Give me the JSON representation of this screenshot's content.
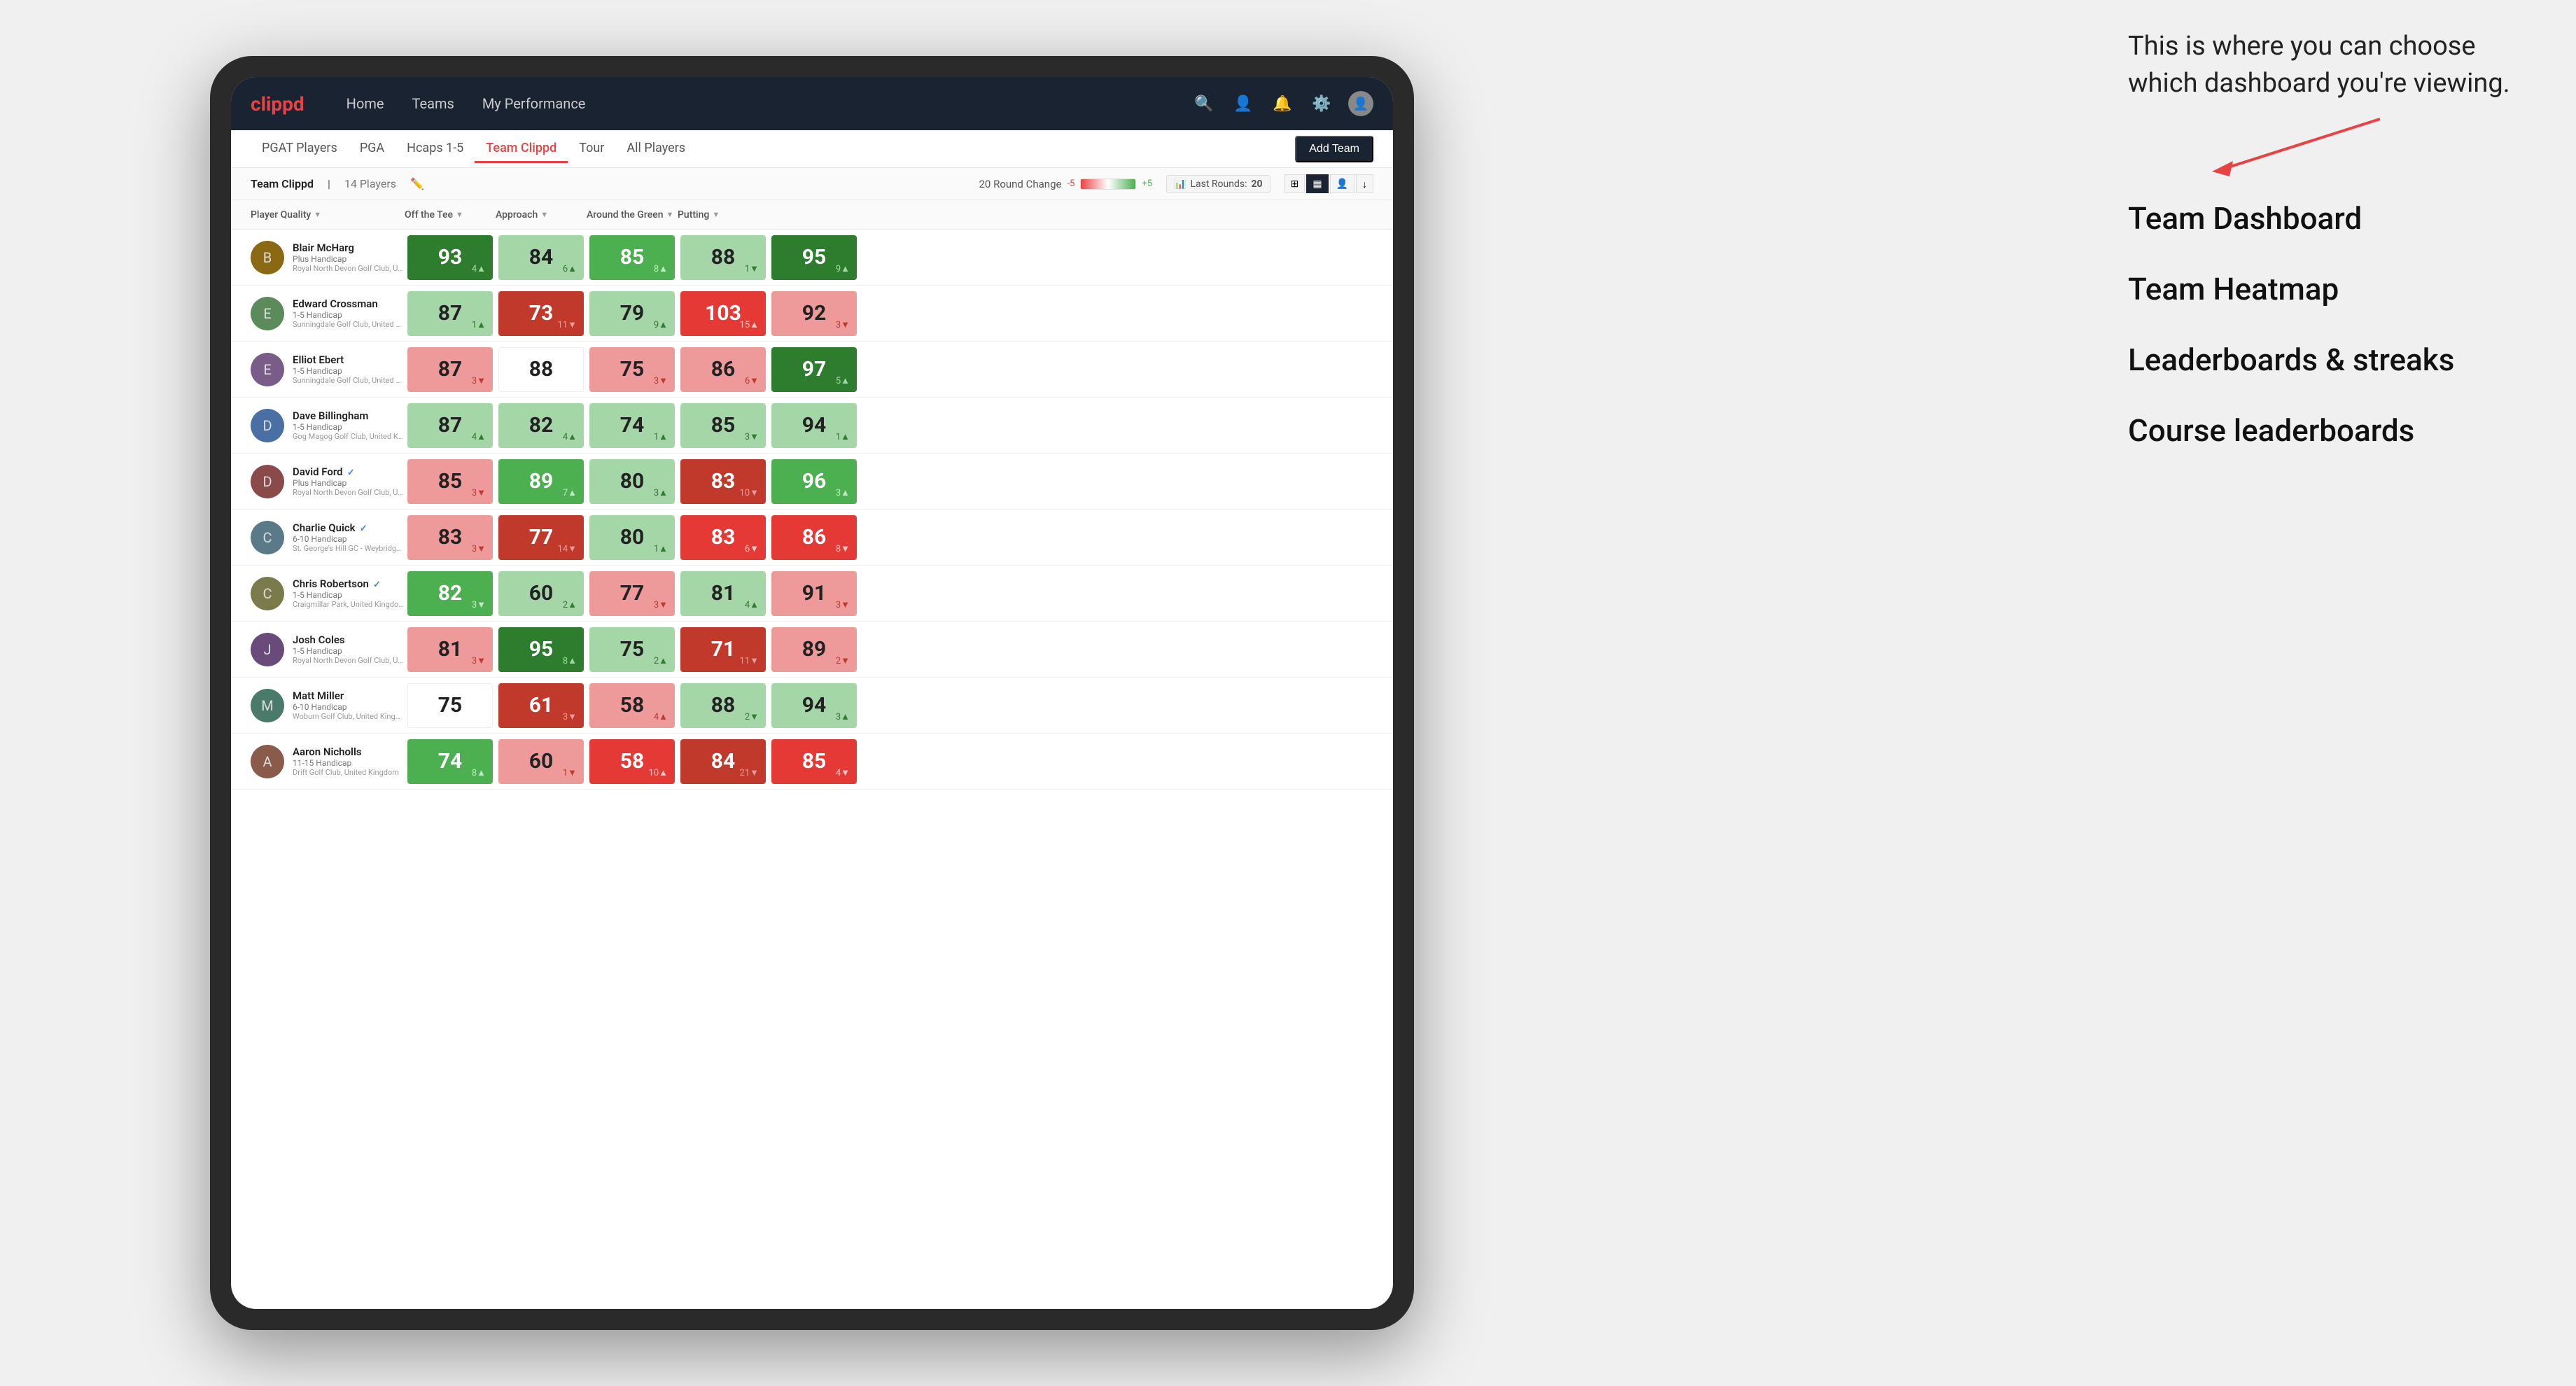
{
  "annotation": {
    "intro": "This is where you can choose which dashboard you're viewing.",
    "options": [
      "Team Dashboard",
      "Team Heatmap",
      "Leaderboards & streaks",
      "Course leaderboards"
    ]
  },
  "nav": {
    "logo": "clippd",
    "items": [
      "Home",
      "Teams",
      "My Performance"
    ],
    "icons": [
      "search",
      "person",
      "bell",
      "settings",
      "avatar"
    ]
  },
  "subnav": {
    "items": [
      "PGAT Players",
      "PGA",
      "Hcaps 1-5",
      "Team Clippd",
      "Tour",
      "All Players"
    ],
    "active": "Team Clippd",
    "add_team_label": "Add Team"
  },
  "team_header": {
    "team_name": "Team Clippd",
    "separator": "|",
    "player_count": "14 Players",
    "round_change_label": "20 Round Change",
    "change_neg": "-5",
    "change_pos": "+5",
    "last_rounds_label": "Last Rounds:",
    "last_rounds_value": "20"
  },
  "col_headers": [
    {
      "label": "Player Quality",
      "has_arrow": true
    },
    {
      "label": "Off the Tee",
      "has_arrow": true
    },
    {
      "label": "Approach",
      "has_arrow": true
    },
    {
      "label": "Around the Green",
      "has_arrow": true
    },
    {
      "label": "Putting",
      "has_arrow": true
    }
  ],
  "players": [
    {
      "name": "Blair McHarg",
      "handicap": "Plus Handicap",
      "club": "Royal North Devon Golf Club, United Kingdom",
      "verified": false,
      "scores": [
        {
          "value": 93,
          "change": "+4",
          "dir": "up",
          "color": "green-dark"
        },
        {
          "value": 84,
          "change": "+6",
          "dir": "up",
          "color": "green-light"
        },
        {
          "value": 85,
          "change": "+8",
          "dir": "up",
          "color": "green-mid"
        },
        {
          "value": 88,
          "change": "-1",
          "dir": "down",
          "color": "green-light"
        },
        {
          "value": 95,
          "change": "+9",
          "dir": "up",
          "color": "green-dark"
        }
      ]
    },
    {
      "name": "Edward Crossman",
      "handicap": "1-5 Handicap",
      "club": "Sunningdale Golf Club, United Kingdom",
      "verified": false,
      "scores": [
        {
          "value": 87,
          "change": "+1",
          "dir": "up",
          "color": "green-light"
        },
        {
          "value": 73,
          "change": "-11",
          "dir": "down",
          "color": "red-dark"
        },
        {
          "value": 79,
          "change": "+9",
          "dir": "up",
          "color": "green-light"
        },
        {
          "value": 103,
          "change": "+15",
          "dir": "up",
          "color": "red-mid"
        },
        {
          "value": 92,
          "change": "-3",
          "dir": "down",
          "color": "red-light"
        }
      ]
    },
    {
      "name": "Elliot Ebert",
      "handicap": "1-5 Handicap",
      "club": "Sunningdale Golf Club, United Kingdom",
      "verified": false,
      "scores": [
        {
          "value": 87,
          "change": "-3",
          "dir": "down",
          "color": "red-light"
        },
        {
          "value": 88,
          "change": "",
          "dir": "",
          "color": "white"
        },
        {
          "value": 75,
          "change": "-3",
          "dir": "down",
          "color": "red-light"
        },
        {
          "value": 86,
          "change": "-6",
          "dir": "down",
          "color": "red-light"
        },
        {
          "value": 97,
          "change": "+5",
          "dir": "up",
          "color": "green-dark"
        }
      ]
    },
    {
      "name": "Dave Billingham",
      "handicap": "1-5 Handicap",
      "club": "Gog Magog Golf Club, United Kingdom",
      "verified": false,
      "scores": [
        {
          "value": 87,
          "change": "+4",
          "dir": "up",
          "color": "green-light"
        },
        {
          "value": 82,
          "change": "+4",
          "dir": "up",
          "color": "green-light"
        },
        {
          "value": 74,
          "change": "+1",
          "dir": "up",
          "color": "green-light"
        },
        {
          "value": 85,
          "change": "-3",
          "dir": "down",
          "color": "green-light"
        },
        {
          "value": 94,
          "change": "+1",
          "dir": "up",
          "color": "green-light"
        }
      ]
    },
    {
      "name": "David Ford",
      "handicap": "Plus Handicap",
      "club": "Royal North Devon Golf Club, United Kingdom",
      "verified": true,
      "scores": [
        {
          "value": 85,
          "change": "-3",
          "dir": "down",
          "color": "red-light"
        },
        {
          "value": 89,
          "change": "+7",
          "dir": "up",
          "color": "green-mid"
        },
        {
          "value": 80,
          "change": "+3",
          "dir": "up",
          "color": "green-light"
        },
        {
          "value": 83,
          "change": "-10",
          "dir": "down",
          "color": "red-dark"
        },
        {
          "value": 96,
          "change": "+3",
          "dir": "up",
          "color": "green-mid"
        }
      ]
    },
    {
      "name": "Charlie Quick",
      "handicap": "6-10 Handicap",
      "club": "St. George's Hill GC - Weybridge - Surrey, Uni...",
      "verified": true,
      "scores": [
        {
          "value": 83,
          "change": "-3",
          "dir": "down",
          "color": "red-light"
        },
        {
          "value": 77,
          "change": "-14",
          "dir": "down",
          "color": "red-dark"
        },
        {
          "value": 80,
          "change": "+1",
          "dir": "up",
          "color": "green-light"
        },
        {
          "value": 83,
          "change": "-6",
          "dir": "down",
          "color": "red-mid"
        },
        {
          "value": 86,
          "change": "-8",
          "dir": "down",
          "color": "red-mid"
        }
      ]
    },
    {
      "name": "Chris Robertson",
      "handicap": "1-5 Handicap",
      "club": "Craigmillar Park, United Kingdom",
      "verified": true,
      "scores": [
        {
          "value": 82,
          "change": "-3",
          "dir": "down",
          "color": "green-mid"
        },
        {
          "value": 60,
          "change": "+2",
          "dir": "up",
          "color": "green-light"
        },
        {
          "value": 77,
          "change": "-3",
          "dir": "down",
          "color": "red-light"
        },
        {
          "value": 81,
          "change": "+4",
          "dir": "up",
          "color": "green-light"
        },
        {
          "value": 91,
          "change": "-3",
          "dir": "down",
          "color": "red-light"
        }
      ]
    },
    {
      "name": "Josh Coles",
      "handicap": "1-5 Handicap",
      "club": "Royal North Devon Golf Club, United Kingdom",
      "verified": false,
      "scores": [
        {
          "value": 81,
          "change": "-3",
          "dir": "down",
          "color": "red-light"
        },
        {
          "value": 95,
          "change": "+8",
          "dir": "up",
          "color": "green-dark"
        },
        {
          "value": 75,
          "change": "+2",
          "dir": "up",
          "color": "green-light"
        },
        {
          "value": 71,
          "change": "-11",
          "dir": "down",
          "color": "red-dark"
        },
        {
          "value": 89,
          "change": "-2",
          "dir": "down",
          "color": "red-light"
        }
      ]
    },
    {
      "name": "Matt Miller",
      "handicap": "6-10 Handicap",
      "club": "Woburn Golf Club, United Kingdom",
      "verified": false,
      "scores": [
        {
          "value": 75,
          "change": "",
          "dir": "",
          "color": "white"
        },
        {
          "value": 61,
          "change": "-3",
          "dir": "down",
          "color": "red-dark"
        },
        {
          "value": 58,
          "change": "+4",
          "dir": "up",
          "color": "red-light"
        },
        {
          "value": 88,
          "change": "-2",
          "dir": "down",
          "color": "green-light"
        },
        {
          "value": 94,
          "change": "+3",
          "dir": "up",
          "color": "green-light"
        }
      ]
    },
    {
      "name": "Aaron Nicholls",
      "handicap": "11-15 Handicap",
      "club": "Drift Golf Club, United Kingdom",
      "verified": false,
      "scores": [
        {
          "value": 74,
          "change": "+8",
          "dir": "up",
          "color": "green-mid"
        },
        {
          "value": 60,
          "change": "-1",
          "dir": "down",
          "color": "red-light"
        },
        {
          "value": 58,
          "change": "+10",
          "dir": "up",
          "color": "red-mid"
        },
        {
          "value": 84,
          "change": "-21",
          "dir": "down",
          "color": "red-dark"
        },
        {
          "value": 85,
          "change": "-4",
          "dir": "down",
          "color": "red-mid"
        }
      ]
    }
  ],
  "colors": {
    "green_dark": "#2e7d2e",
    "green_mid": "#4caf50",
    "green_light": "#a5d6a7",
    "red_dark": "#c0392b",
    "red_mid": "#e53935",
    "red_light": "#ef9a9a",
    "white": "#ffffff",
    "nav_bg": "#1a2332",
    "logo_color": "#e84242"
  }
}
